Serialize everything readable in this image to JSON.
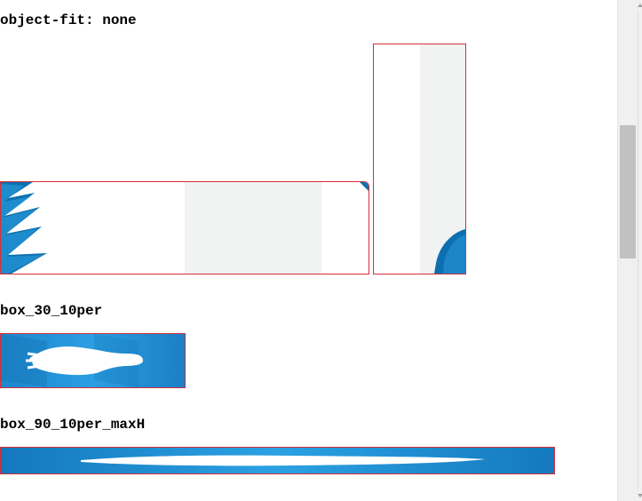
{
  "sections": {
    "fit": {
      "label": "object-fit: none"
    },
    "box_30": {
      "label": "box_30_10per"
    },
    "box_90": {
      "label": "box_90_10per_maxH"
    }
  },
  "colors": {
    "border": "#d32f3a",
    "blue_dark": "#0e6fb0",
    "blue_light": "#2a9ee0",
    "gray_panel": "#f1f2f2"
  },
  "icons": {
    "scroll_up": "scroll-up-arrow-icon",
    "scroll_down": "scroll-down-arrow-icon"
  }
}
